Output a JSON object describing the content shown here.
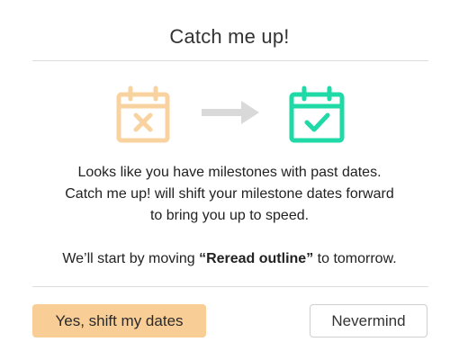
{
  "dialog": {
    "title": "Catch me up!",
    "icons": {
      "past_calendar": "calendar-x-icon",
      "arrow": "arrow-right-icon",
      "current_calendar": "calendar-check-icon"
    },
    "colors": {
      "past_calendar": "#f8d3a0",
      "arrow": "#d9d9d9",
      "current_calendar": "#1fd9a7",
      "primary_button": "#f9cd96"
    },
    "message": {
      "line1": "Looks like you have milestones with past dates.",
      "line2": "Catch me up! will shift your milestone dates forward",
      "line3": "to bring you up to speed.",
      "line4_prefix": "We’ll start by moving ",
      "line4_bold": "“Reread outline”",
      "line4_suffix": " to tomorrow."
    },
    "buttons": {
      "primary_label": "Yes, shift my dates",
      "secondary_label": "Nevermind"
    }
  }
}
